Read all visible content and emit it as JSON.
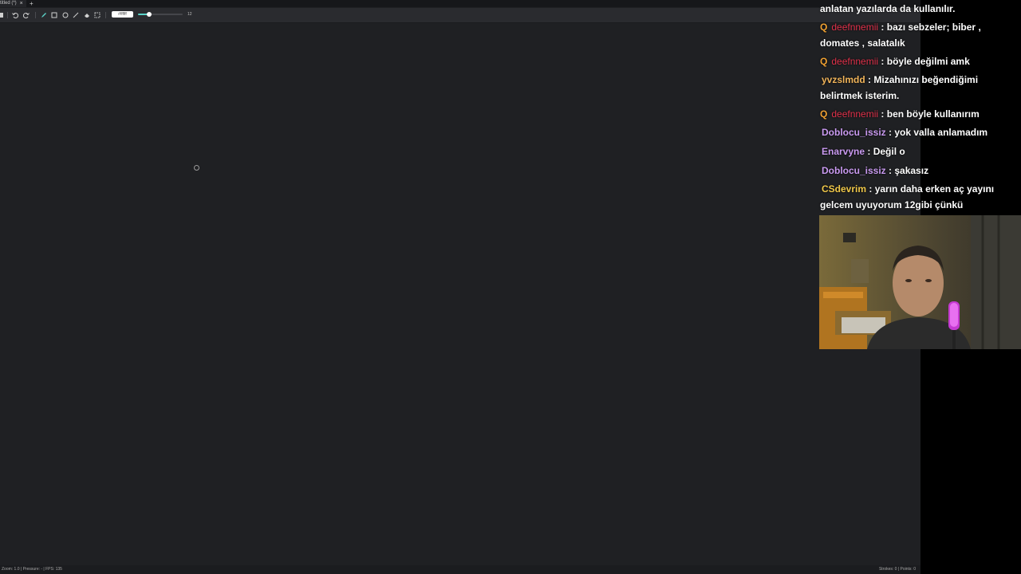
{
  "app": {
    "tab_title": "titled (*)",
    "tab_close": "×",
    "tab_add": "+",
    "toolbar": {
      "color_label": "#ffffff",
      "brush_size_fraction": 0.25,
      "size_value": "12"
    },
    "status": {
      "left": "Zoom: 1.0 | Pressure: - | FPS: 135",
      "right": "Strokes: 0 | Points: 0"
    }
  },
  "chat": {
    "messages": [
      {
        "user": "",
        "text": "anlatan yazılarda da kullanılır.",
        "badge": ""
      },
      {
        "user": "deefnnemii",
        "text": ": bazı sebzeler; biber ,",
        "badge": "Q"
      },
      {
        "user": "",
        "text": "domates , salatalık",
        "badge": ""
      },
      {
        "user": "deefnnemii",
        "text": ": böyle değilmi amk",
        "badge": "Q"
      },
      {
        "user": "yvzslmdd",
        "text": ": Mizahınızı beğendiğimi",
        "badge": ""
      },
      {
        "user": "",
        "text": "belirtmek isterim.",
        "badge": ""
      },
      {
        "user": "deefnnemii",
        "text": ": ben böyle kullanırım",
        "badge": "Q"
      },
      {
        "user": "Doblocu_issiz",
        "text": ": yok valla anlamadım",
        "badge": ""
      },
      {
        "user": "Enarvyne",
        "text": ": Değil o",
        "badge": ""
      },
      {
        "user": "Doblocu_issiz",
        "text": ": şakasız",
        "badge": ""
      },
      {
        "user": "CSdevrim",
        "text": ": yarın daha erken aç yayını",
        "badge": ""
      },
      {
        "user": "",
        "text": "gelcem uyuyorum 12gibi çünkü",
        "badge": ""
      }
    ]
  }
}
